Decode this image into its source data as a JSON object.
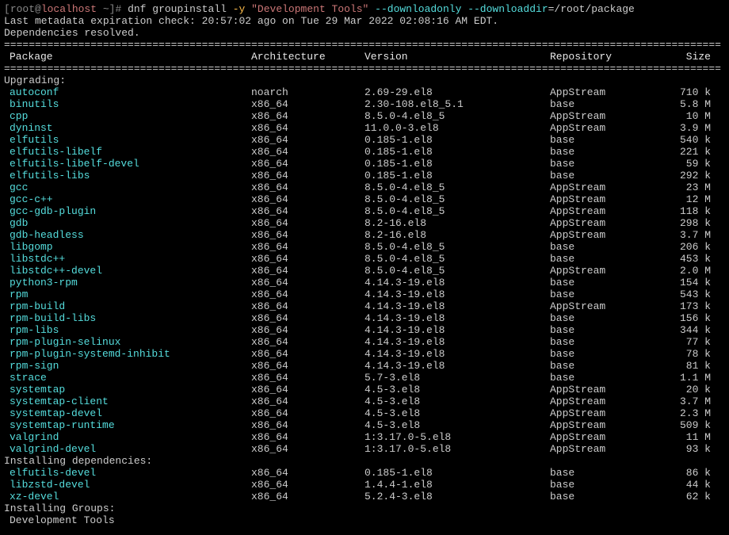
{
  "prompt": {
    "open": "[",
    "user": "root@",
    "host": "localhost",
    "path": " ~]#",
    "cmd1": " dnf groupinstall ",
    "flag_y": "-y",
    "sp1": " ",
    "quoted": "\"Development Tools\"",
    "sp2": " ",
    "opt1": "--downloadonly",
    "sp3": " ",
    "opt2": "--downloaddir",
    "rest": "=/root/package"
  },
  "meta": {
    "line1": "Last metadata expiration check: 20:57:02 ago on Tue 29 Mar 2022 02:08:16 AM EDT.",
    "line2": "Dependencies resolved."
  },
  "header": {
    "pkg": "Package",
    "arch": "Architecture",
    "ver": "Version",
    "repo": "Repository",
    "size": "Size"
  },
  "sections": {
    "upgrading": "Upgrading:",
    "installing_deps": "Installing dependencies:",
    "installing_groups": "Installing Groups:",
    "group_name": "Development Tools"
  },
  "upgrading": [
    {
      "pkg": "autoconf",
      "arch": "noarch",
      "ver": "2.69-29.el8",
      "repo": "AppStream",
      "size": "710 k"
    },
    {
      "pkg": "binutils",
      "arch": "x86_64",
      "ver": "2.30-108.el8_5.1",
      "repo": "base",
      "size": "5.8 M"
    },
    {
      "pkg": "cpp",
      "arch": "x86_64",
      "ver": "8.5.0-4.el8_5",
      "repo": "AppStream",
      "size": "10 M"
    },
    {
      "pkg": "dyninst",
      "arch": "x86_64",
      "ver": "11.0.0-3.el8",
      "repo": "AppStream",
      "size": "3.9 M"
    },
    {
      "pkg": "elfutils",
      "arch": "x86_64",
      "ver": "0.185-1.el8",
      "repo": "base",
      "size": "540 k"
    },
    {
      "pkg": "elfutils-libelf",
      "arch": "x86_64",
      "ver": "0.185-1.el8",
      "repo": "base",
      "size": "221 k"
    },
    {
      "pkg": "elfutils-libelf-devel",
      "arch": "x86_64",
      "ver": "0.185-1.el8",
      "repo": "base",
      "size": "59 k"
    },
    {
      "pkg": "elfutils-libs",
      "arch": "x86_64",
      "ver": "0.185-1.el8",
      "repo": "base",
      "size": "292 k"
    },
    {
      "pkg": "gcc",
      "arch": "x86_64",
      "ver": "8.5.0-4.el8_5",
      "repo": "AppStream",
      "size": "23 M"
    },
    {
      "pkg": "gcc-c++",
      "arch": "x86_64",
      "ver": "8.5.0-4.el8_5",
      "repo": "AppStream",
      "size": "12 M"
    },
    {
      "pkg": "gcc-gdb-plugin",
      "arch": "x86_64",
      "ver": "8.5.0-4.el8_5",
      "repo": "AppStream",
      "size": "118 k"
    },
    {
      "pkg": "gdb",
      "arch": "x86_64",
      "ver": "8.2-16.el8",
      "repo": "AppStream",
      "size": "298 k"
    },
    {
      "pkg": "gdb-headless",
      "arch": "x86_64",
      "ver": "8.2-16.el8",
      "repo": "AppStream",
      "size": "3.7 M"
    },
    {
      "pkg": "libgomp",
      "arch": "x86_64",
      "ver": "8.5.0-4.el8_5",
      "repo": "base",
      "size": "206 k"
    },
    {
      "pkg": "libstdc++",
      "arch": "x86_64",
      "ver": "8.5.0-4.el8_5",
      "repo": "base",
      "size": "453 k"
    },
    {
      "pkg": "libstdc++-devel",
      "arch": "x86_64",
      "ver": "8.5.0-4.el8_5",
      "repo": "AppStream",
      "size": "2.0 M"
    },
    {
      "pkg": "python3-rpm",
      "arch": "x86_64",
      "ver": "4.14.3-19.el8",
      "repo": "base",
      "size": "154 k"
    },
    {
      "pkg": "rpm",
      "arch": "x86_64",
      "ver": "4.14.3-19.el8",
      "repo": "base",
      "size": "543 k"
    },
    {
      "pkg": "rpm-build",
      "arch": "x86_64",
      "ver": "4.14.3-19.el8",
      "repo": "AppStream",
      "size": "173 k"
    },
    {
      "pkg": "rpm-build-libs",
      "arch": "x86_64",
      "ver": "4.14.3-19.el8",
      "repo": "base",
      "size": "156 k"
    },
    {
      "pkg": "rpm-libs",
      "arch": "x86_64",
      "ver": "4.14.3-19.el8",
      "repo": "base",
      "size": "344 k"
    },
    {
      "pkg": "rpm-plugin-selinux",
      "arch": "x86_64",
      "ver": "4.14.3-19.el8",
      "repo": "base",
      "size": "77 k"
    },
    {
      "pkg": "rpm-plugin-systemd-inhibit",
      "arch": "x86_64",
      "ver": "4.14.3-19.el8",
      "repo": "base",
      "size": "78 k"
    },
    {
      "pkg": "rpm-sign",
      "arch": "x86_64",
      "ver": "4.14.3-19.el8",
      "repo": "base",
      "size": "81 k"
    },
    {
      "pkg": "strace",
      "arch": "x86_64",
      "ver": "5.7-3.el8",
      "repo": "base",
      "size": "1.1 M"
    },
    {
      "pkg": "systemtap",
      "arch": "x86_64",
      "ver": "4.5-3.el8",
      "repo": "AppStream",
      "size": "20 k"
    },
    {
      "pkg": "systemtap-client",
      "arch": "x86_64",
      "ver": "4.5-3.el8",
      "repo": "AppStream",
      "size": "3.7 M"
    },
    {
      "pkg": "systemtap-devel",
      "arch": "x86_64",
      "ver": "4.5-3.el8",
      "repo": "AppStream",
      "size": "2.3 M"
    },
    {
      "pkg": "systemtap-runtime",
      "arch": "x86_64",
      "ver": "4.5-3.el8",
      "repo": "AppStream",
      "size": "509 k"
    },
    {
      "pkg": "valgrind",
      "arch": "x86_64",
      "ver": "1:3.17.0-5.el8",
      "repo": "AppStream",
      "size": "11 M"
    },
    {
      "pkg": "valgrind-devel",
      "arch": "x86_64",
      "ver": "1:3.17.0-5.el8",
      "repo": "AppStream",
      "size": "93 k"
    }
  ],
  "installing_deps": [
    {
      "pkg": "elfutils-devel",
      "arch": "x86_64",
      "ver": "0.185-1.el8",
      "repo": "base",
      "size": "86 k"
    },
    {
      "pkg": "libzstd-devel",
      "arch": "x86_64",
      "ver": "1.4.4-1.el8",
      "repo": "base",
      "size": "44 k"
    },
    {
      "pkg": "xz-devel",
      "arch": "x86_64",
      "ver": "5.2.4-3.el8",
      "repo": "base",
      "size": "62 k"
    }
  ]
}
